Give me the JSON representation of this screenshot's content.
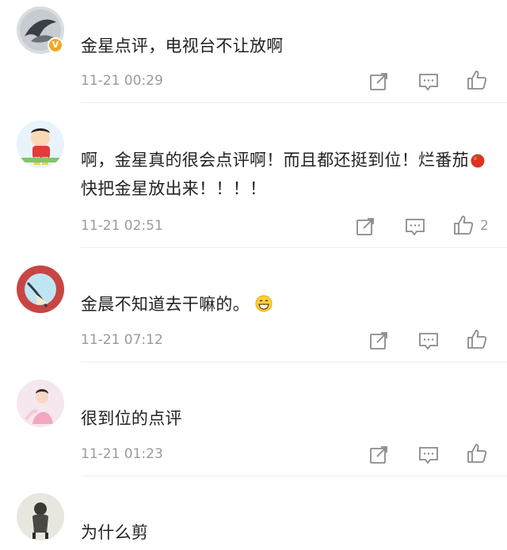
{
  "comments": [
    {
      "text": "金星点评，电视台不让放啊",
      "time": "11-21 00:29",
      "likes": "",
      "verified": true,
      "verified_badge": "V"
    },
    {
      "text_part1": "啊，金星真的很会点评啊！而且都还挺到位！烂番茄",
      "text_part2": "快把金星放出来！！！！",
      "time": "11-21 02:51",
      "likes": "2"
    },
    {
      "text": "金晨不知道去干嘛的。",
      "time": "11-21 07:12",
      "likes": ""
    },
    {
      "text": "很到位的点评",
      "time": "11-21 01:23",
      "likes": ""
    },
    {
      "text": "为什么剪",
      "time": "",
      "likes": ""
    }
  ],
  "icons": {
    "share": "share-icon",
    "comment": "comment-icon",
    "like": "like-icon",
    "tomato": "tomato-emoji",
    "grin": "grin-emoji"
  },
  "colors": {
    "badge": "#f5a623",
    "text": "#222222",
    "meta": "#9a9a9a",
    "icon": "#8a8a8a"
  }
}
